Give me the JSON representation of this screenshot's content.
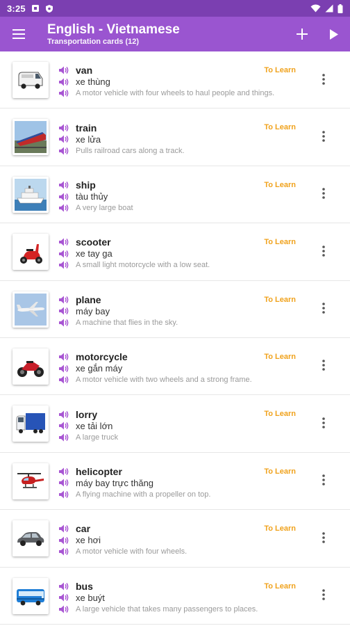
{
  "status_bar": {
    "time": "3:25",
    "icons": [
      "notification-square-icon",
      "shield-icon",
      "wifi-icon",
      "signal-icon",
      "battery-icon"
    ]
  },
  "header": {
    "title": "English - Vietnamese",
    "subtitle": "Transportation cards (12)",
    "icons": [
      "menu-icon",
      "add-icon",
      "play-icon"
    ]
  },
  "colors": {
    "status_bar": "#7b3fb1",
    "app_bar": "#9a55d0",
    "speaker": "#a855d3",
    "status_label": "#f0a21c"
  },
  "cards": [
    {
      "term": "van",
      "translation": "xe thùng",
      "definition": "A motor vehicle with four wheels to haul people and things.",
      "status": "To Learn",
      "image": "van-image"
    },
    {
      "term": "train",
      "translation": "xe lửa",
      "definition": "Pulls railroad cars along a track.",
      "status": "To Learn",
      "image": "train-image"
    },
    {
      "term": "ship",
      "translation": "tàu thủy",
      "definition": "A very large boat",
      "status": "To Learn",
      "image": "ship-image"
    },
    {
      "term": "scooter",
      "translation": "xe tay ga",
      "definition": "A small light motorcycle with a low seat.",
      "status": "To Learn",
      "image": "scooter-image"
    },
    {
      "term": "plane",
      "translation": "máy bay",
      "definition": "A machine that flies in the sky.",
      "status": "To Learn",
      "image": "plane-image"
    },
    {
      "term": "motorcycle",
      "translation": "xe gắn máy",
      "definition": "A motor vehicle with two wheels and a strong frame.",
      "status": "To Learn",
      "image": "motorcycle-image"
    },
    {
      "term": "lorry",
      "translation": "xe tải lớn",
      "definition": "A large truck",
      "status": "To Learn",
      "image": "lorry-image"
    },
    {
      "term": "helicopter",
      "translation": "máy bay trực thăng",
      "definition": "A flying machine with a propeller on top.",
      "status": "To Learn",
      "image": "helicopter-image"
    },
    {
      "term": "car",
      "translation": "xe hơi",
      "definition": "A motor vehicle with four wheels.",
      "status": "To Learn",
      "image": "car-image"
    },
    {
      "term": "bus",
      "translation": "xe buýt",
      "definition": "A large vehicle that takes many passengers to places.",
      "status": "To Learn",
      "image": "bus-image"
    }
  ]
}
